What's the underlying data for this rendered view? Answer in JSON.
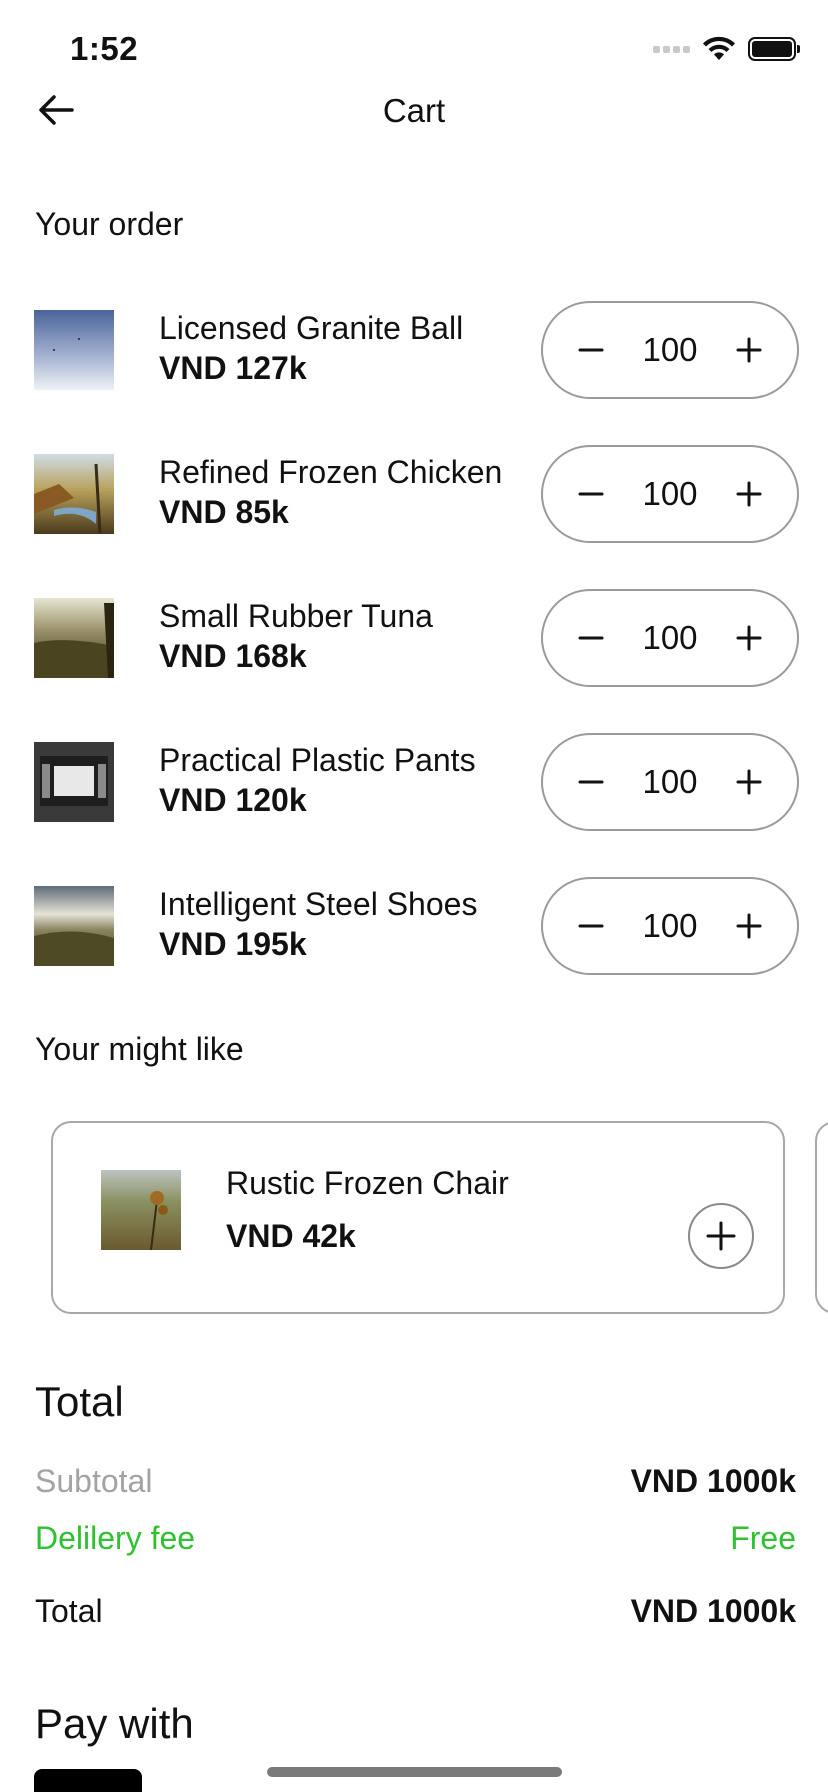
{
  "status_bar": {
    "time": "1:52"
  },
  "header": {
    "title": "Cart"
  },
  "order": {
    "title": "Your order",
    "items": [
      {
        "name": "Licensed Granite Ball",
        "price": "VND 127k",
        "quantity": "100"
      },
      {
        "name": "Refined Frozen Chicken",
        "price": "VND 85k",
        "quantity": "100"
      },
      {
        "name": "Small Rubber Tuna",
        "price": "VND 168k",
        "quantity": "100"
      },
      {
        "name": "Practical Plastic Pants",
        "price": "VND 120k",
        "quantity": "100"
      },
      {
        "name": "Intelligent Steel Shoes",
        "price": "VND 195k",
        "quantity": "100"
      }
    ]
  },
  "suggestions": {
    "title": "Your might like",
    "items": [
      {
        "name": "Rustic Frozen Chair",
        "price": "VND 42k"
      }
    ]
  },
  "totals": {
    "heading": "Total",
    "subtotal_label": "Subtotal",
    "subtotal_value": "VND 1000k",
    "delivery_label": "Delilery fee",
    "delivery_value": "Free",
    "total_label": "Total",
    "total_value": "VND 1000k"
  },
  "payment": {
    "heading": "Pay with"
  },
  "colors": {
    "accent_green": "#2fc22f",
    "muted_text": "#a3a3a3",
    "border": "#9a9a9a"
  }
}
